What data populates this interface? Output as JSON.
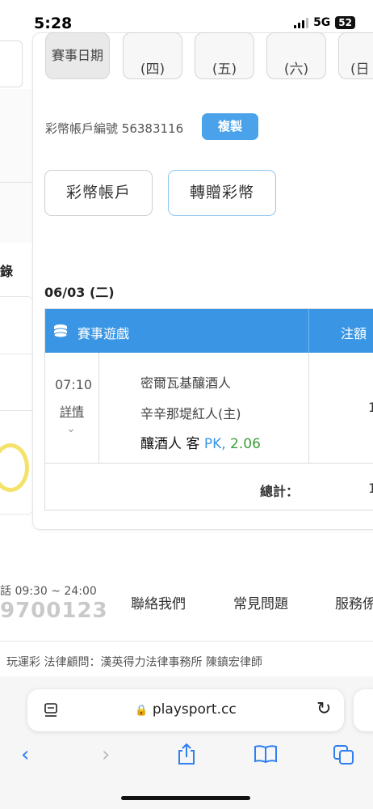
{
  "status": {
    "time": "5:28",
    "network": "5G",
    "battery": "52"
  },
  "sidebar": {
    "section_label": "錄"
  },
  "date_row": {
    "label": "賽事日期",
    "days": [
      {
        "weekday": "(四)"
      },
      {
        "weekday": "(五)"
      },
      {
        "weekday": "(六)"
      },
      {
        "weekday": "(日"
      }
    ]
  },
  "account": {
    "label": "彩幣帳戶編號",
    "number": "56383116",
    "copy_label": "複製"
  },
  "actions": {
    "wallet_label": "彩幣帳戶",
    "transfer_label": "轉贈彩幣"
  },
  "records": {
    "date": "06/03 (二)",
    "columns": {
      "game": "賽事遊戲",
      "amount": "注額"
    },
    "rows": [
      {
        "time": "07:10",
        "detail_label": "詳情",
        "team1": "密爾瓦基釀酒人",
        "team2": "辛辛那堤紅人(主)",
        "pick": "釀酒人 客",
        "type": "PK,",
        "odds": "2.06",
        "amount_peek": "1"
      }
    ],
    "total_label": "總計：",
    "total_peek": "1"
  },
  "footer": {
    "hours": "話 09:30 ~ 24:00",
    "phone": "9700123",
    "links": [
      "聯絡我們",
      "常見問題",
      "服務係"
    ],
    "legal": "玩運彩 法律顧問：漢英得力法律事務所 陳鎮宏律師"
  },
  "browser": {
    "url": "playsport.cc"
  },
  "colors": {
    "accent": "#3a96e4",
    "copy_button": "#4aa3ea",
    "odds_green": "#3c9e3c"
  }
}
